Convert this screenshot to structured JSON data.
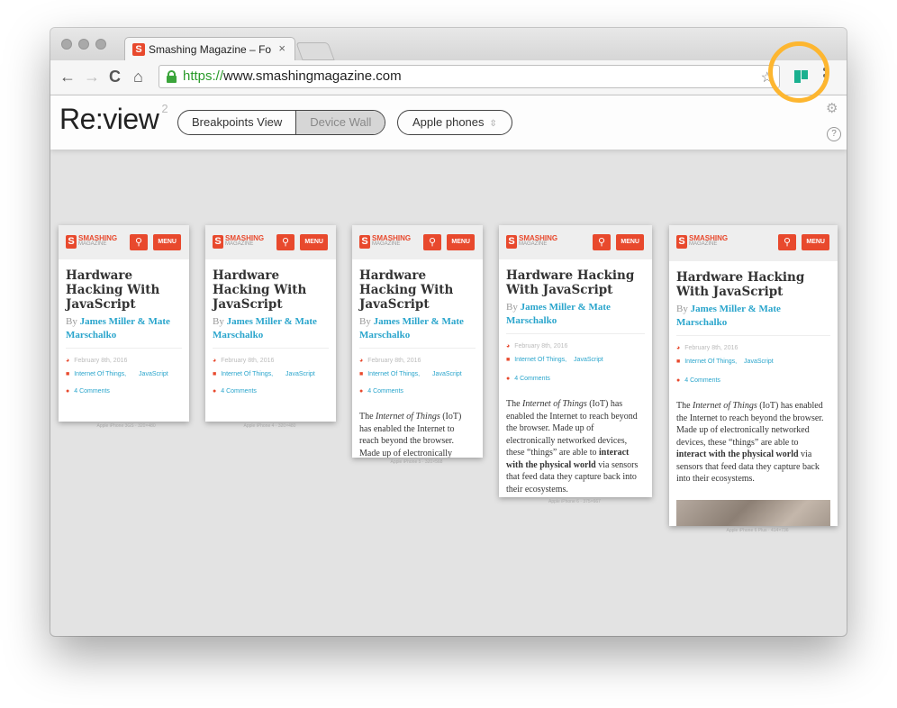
{
  "browser": {
    "tab_title": "Smashing Magazine – For P",
    "tab_favicon": "S",
    "tab_close_icon": "×",
    "url_protocol": "https://",
    "url_host": "www.smashingmagazine.com",
    "back_icon": "←",
    "forward_icon": "→",
    "reload_icon": "C",
    "home_icon": "⌂",
    "star_icon": "☆",
    "extension_color": "#19b08f",
    "highlight_color": "#fdb630"
  },
  "app": {
    "logo": "Re:view",
    "logo_version": "2",
    "view_tabs": [
      "Breakpoints View",
      "Device Wall"
    ],
    "active_view": "Device Wall",
    "device_select": "Apple phones",
    "device_select_arrow": "⇳",
    "settings_icon": "⚙",
    "help_icon": "?"
  },
  "article": {
    "logo_letter": "S",
    "logo_word": "SMASHING",
    "logo_sub": "MAGAZINE",
    "search_icon": "⚲",
    "menu_label": "MENU",
    "title": "Hardware Hacking With JavaScript",
    "by": "By",
    "authors": "James Miller & Mate Marschalko",
    "date": "February 8th, 2016",
    "tags": [
      "Internet Of Things,",
      "JavaScript"
    ],
    "comments": "4 Comments",
    "intro_part1": "The",
    "intro_italic": "Internet of Things",
    "intro_part2": "(IoT) has enabled the Internet to reach beyond the browser. Made up of electronically networked devices, these “things” are able to",
    "intro_bold": "interact with the physical world",
    "intro_part3": "via sensors that feed data they capture back into their ecosystems.",
    "date_icon": "◕",
    "tag_icon": "■",
    "comment_icon": "●"
  },
  "devices": [
    {
      "caption": "Apple iPhone 3GS · 320×480"
    },
    {
      "caption": "Apple iPhone 4 · 320×480"
    },
    {
      "caption": "Apple iPhone 5 · 320×568"
    },
    {
      "caption": "Apple iPhone 6 · 375×667"
    },
    {
      "caption": "Apple iPhone 6 Plus · 414×736"
    }
  ]
}
